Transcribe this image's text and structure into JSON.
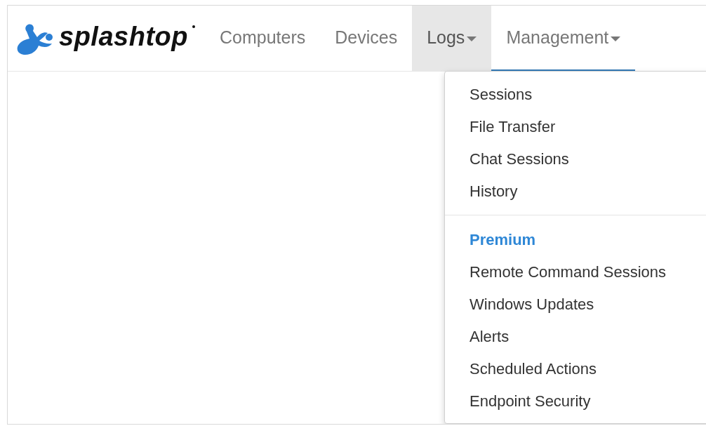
{
  "navbar": {
    "logo_text": "splashtop",
    "items": [
      {
        "label": "Computers",
        "has_caret": false,
        "open": false,
        "selected": false
      },
      {
        "label": "Devices",
        "has_caret": false,
        "open": false,
        "selected": false
      },
      {
        "label": "Logs",
        "has_caret": true,
        "open": true,
        "selected": false
      },
      {
        "label": "Management",
        "has_caret": true,
        "open": false,
        "selected": true
      }
    ]
  },
  "dropdown": {
    "items": [
      {
        "kind": "item",
        "label": "Sessions"
      },
      {
        "kind": "item",
        "label": "File Transfer"
      },
      {
        "kind": "item",
        "label": "Chat Sessions"
      },
      {
        "kind": "item",
        "label": "History"
      },
      {
        "kind": "divider"
      },
      {
        "kind": "header",
        "label": "Premium"
      },
      {
        "kind": "item",
        "label": "Remote Command Sessions"
      },
      {
        "kind": "item",
        "label": "Windows Updates"
      },
      {
        "kind": "item",
        "label": "Alerts"
      },
      {
        "kind": "item",
        "label": "Scheduled Actions"
      },
      {
        "kind": "item",
        "label": "Endpoint Security"
      }
    ]
  }
}
